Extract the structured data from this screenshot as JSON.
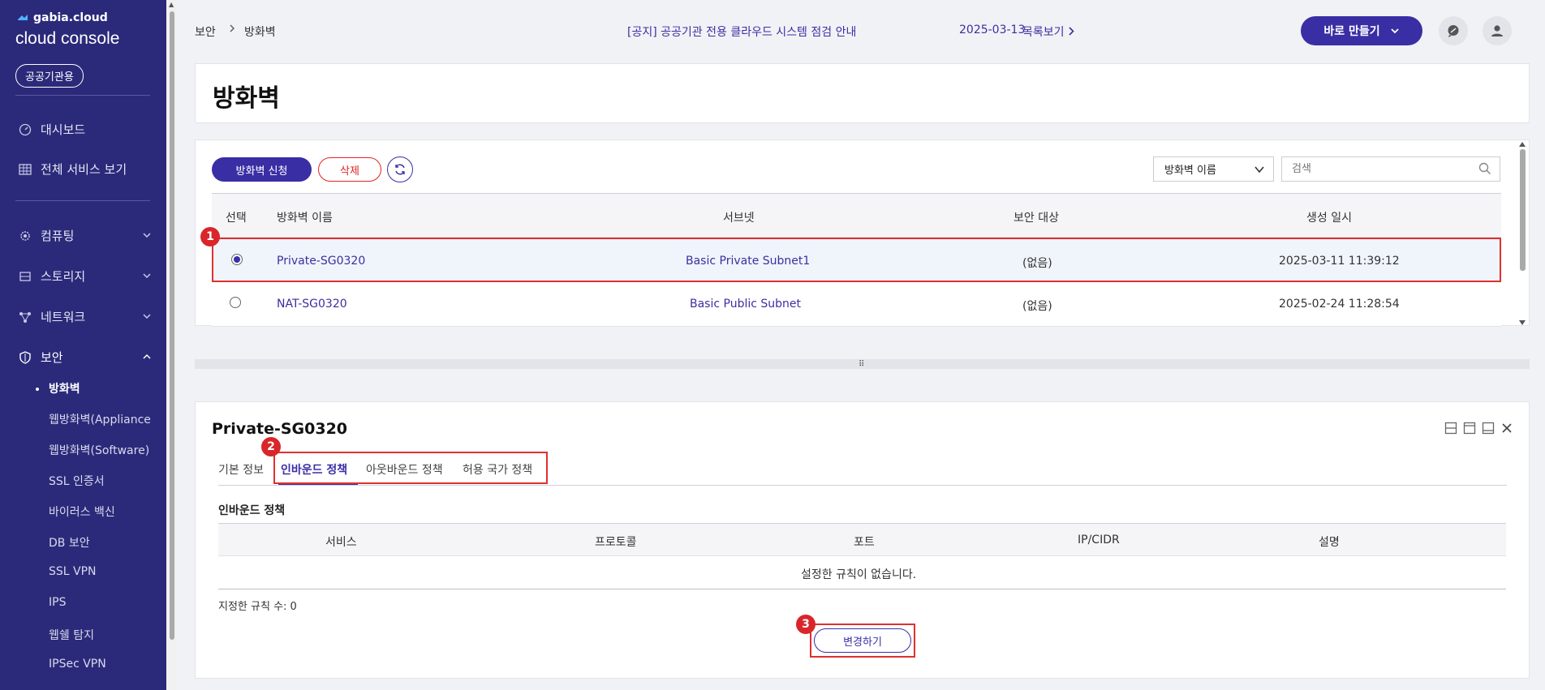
{
  "sidebar": {
    "brand_small": "gabia.cloud",
    "brand_big": "cloud console",
    "badge": "공공기관용",
    "items": [
      {
        "label": "대시보드"
      },
      {
        "label": "전체 서비스 보기"
      },
      {
        "label": "컴퓨팅"
      },
      {
        "label": "스토리지"
      },
      {
        "label": "네트워크"
      },
      {
        "label": "보안"
      }
    ],
    "sub_items": [
      {
        "label": "방화벽"
      },
      {
        "label": "웹방화벽(Appliance)"
      },
      {
        "label": "웹방화벽(Software)"
      },
      {
        "label": "SSL 인증서"
      },
      {
        "label": "바이러스 백신"
      },
      {
        "label": "DB 보안"
      },
      {
        "label": "SSL VPN"
      },
      {
        "label": "IPS"
      },
      {
        "label": "웹쉘 탐지"
      },
      {
        "label": "IPSec VPN"
      }
    ]
  },
  "topbar": {
    "breadcrumb": [
      "보안",
      "방화벽"
    ],
    "notice": "[공지] 공공기관 전용 클라우드 시스템 점검 안내",
    "notice_date": "2025-03-13",
    "notice_more": "목록보기",
    "create_label": "바로 만들기"
  },
  "page": {
    "title": "방화벽"
  },
  "list": {
    "apply_label": "방화벽 신청",
    "delete_label": "삭제",
    "filter_value": "방화벽 이름",
    "search_placeholder": "검색",
    "columns": [
      "선택",
      "방화벽 이름",
      "서브넷",
      "보안 대상",
      "생성 일시"
    ],
    "rows": [
      {
        "name": "Private-SG0320",
        "subnet": "Basic Private Subnet1",
        "target": "(없음)",
        "created": "2025-03-11 11:39:12",
        "selected": true
      },
      {
        "name": "NAT-SG0320",
        "subnet": "Basic Public Subnet",
        "target": "(없음)",
        "created": "2025-02-24 11:28:54",
        "selected": false
      }
    ]
  },
  "markers": [
    "1",
    "2",
    "3"
  ],
  "detail": {
    "title": "Private-SG0320",
    "tabs": [
      "기본 정보",
      "인바운드 정책",
      "아웃바운드 정책",
      "허용 국가 정책"
    ],
    "active_tab": "인바운드 정책",
    "section_label": "인바운드 정책",
    "columns": [
      "서비스",
      "프로토콜",
      "포트",
      "IP/CIDR",
      "설명"
    ],
    "empty_text": "설정한 규칙이 없습니다.",
    "rule_count_text": "지정한 규칙 수: 0",
    "change_label": "변경하기"
  },
  "colors": {
    "sidebar_bg": "#2b2a7a",
    "accent": "#3a2ea5",
    "highlight": "#e03030",
    "delete": "#e02424"
  }
}
